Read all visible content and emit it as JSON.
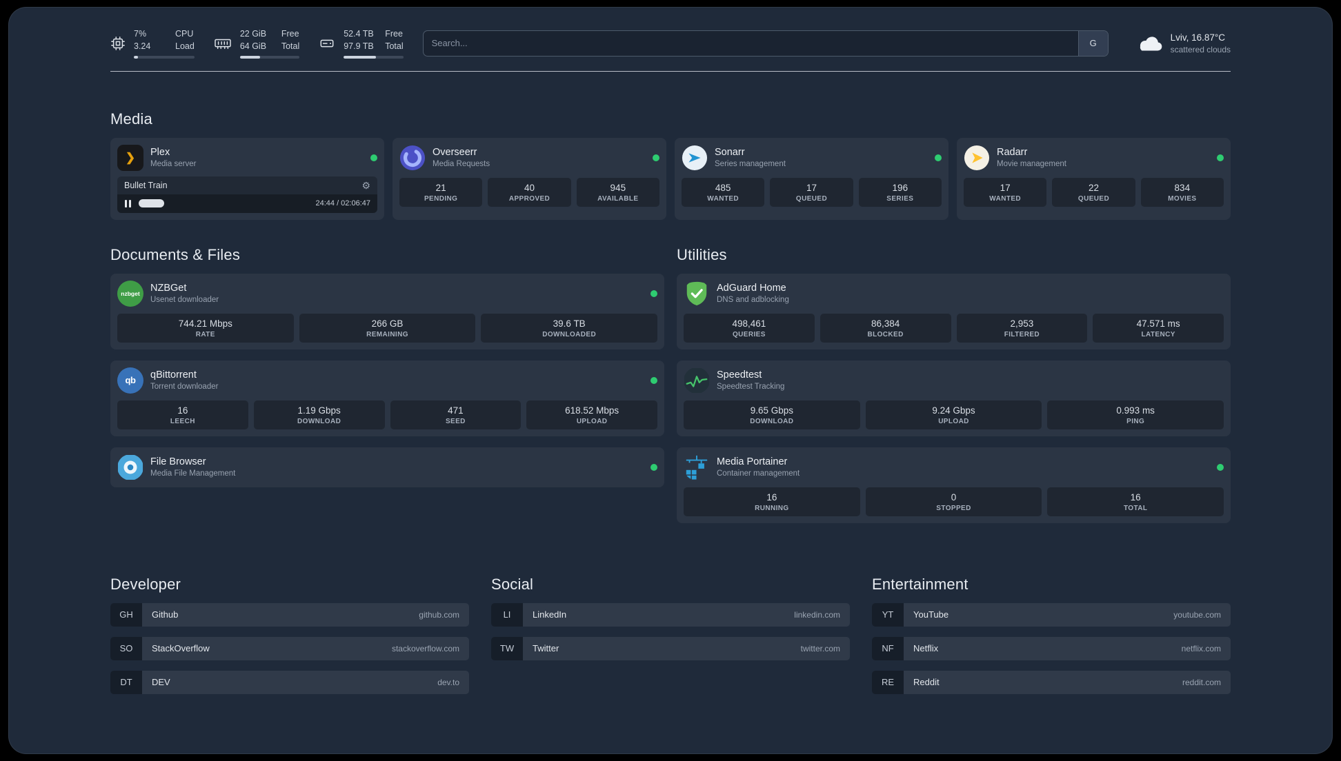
{
  "theme": {
    "accent_green": "#2ecc71",
    "page_bg": "#1f2a3a"
  },
  "topbar": {
    "cpu": {
      "value_top": "7%",
      "value_bottom": "3.24",
      "label_top": "CPU",
      "label_bottom": "Load",
      "bar_percent": 7
    },
    "memory": {
      "value_top": "22 GiB",
      "value_bottom": "64 GiB",
      "label_top": "Free",
      "label_bottom": "Total",
      "bar_percent": 34
    },
    "disk": {
      "value_top": "52.4 TB",
      "value_bottom": "97.9 TB",
      "label_top": "Free",
      "label_bottom": "Total",
      "bar_percent": 54
    },
    "search": {
      "placeholder": "Search...",
      "provider_label": "G"
    },
    "weather": {
      "location": "Lviv, 16.87°C",
      "condition": "scattered clouds"
    }
  },
  "groups": {
    "media": {
      "title": "Media",
      "plex": {
        "name": "Plex",
        "description": "Media server",
        "player": {
          "track": "Bullet Train",
          "time": "24:44 / 02:06:47",
          "progress_percent": 15
        }
      },
      "overseerr": {
        "name": "Overseerr",
        "description": "Media Requests",
        "stats": [
          {
            "value": "21",
            "label": "PENDING"
          },
          {
            "value": "40",
            "label": "APPROVED"
          },
          {
            "value": "945",
            "label": "AVAILABLE"
          }
        ]
      },
      "sonarr": {
        "name": "Sonarr",
        "description": "Series management",
        "stats": [
          {
            "value": "485",
            "label": "WANTED"
          },
          {
            "value": "17",
            "label": "QUEUED"
          },
          {
            "value": "196",
            "label": "SERIES"
          }
        ]
      },
      "radarr": {
        "name": "Radarr",
        "description": "Movie management",
        "stats": [
          {
            "value": "17",
            "label": "WANTED"
          },
          {
            "value": "22",
            "label": "QUEUED"
          },
          {
            "value": "834",
            "label": "MOVIES"
          }
        ]
      }
    },
    "documents": {
      "title": "Documents & Files",
      "nzbget": {
        "name": "NZBGet",
        "description": "Usenet downloader",
        "icon_text": "nzbget",
        "stats": [
          {
            "value": "744.21 Mbps",
            "label": "RATE"
          },
          {
            "value": "266 GB",
            "label": "REMAINING"
          },
          {
            "value": "39.6 TB",
            "label": "DOWNLOADED"
          }
        ]
      },
      "qbittorrent": {
        "name": "qBittorrent",
        "description": "Torrent downloader",
        "icon_text": "qb",
        "stats": [
          {
            "value": "16",
            "label": "LEECH"
          },
          {
            "value": "1.19 Gbps",
            "label": "DOWNLOAD"
          },
          {
            "value": "471",
            "label": "SEED"
          },
          {
            "value": "618.52 Mbps",
            "label": "UPLOAD"
          }
        ]
      },
      "filebrowser": {
        "name": "File Browser",
        "description": "Media File Management"
      }
    },
    "utilities": {
      "title": "Utilities",
      "adguard": {
        "name": "AdGuard Home",
        "description": "DNS and adblocking",
        "stats": [
          {
            "value": "498,461",
            "label": "QUERIES"
          },
          {
            "value": "86,384",
            "label": "BLOCKED"
          },
          {
            "value": "2,953",
            "label": "FILTERED"
          },
          {
            "value": "47.571 ms",
            "label": "LATENCY"
          }
        ]
      },
      "speedtest": {
        "name": "Speedtest",
        "description": "Speedtest Tracking",
        "stats": [
          {
            "value": "9.65 Gbps",
            "label": "DOWNLOAD"
          },
          {
            "value": "9.24 Gbps",
            "label": "UPLOAD"
          },
          {
            "value": "0.993 ms",
            "label": "PING"
          }
        ]
      },
      "portainer": {
        "name": "Media Portainer",
        "description": "Container management",
        "stats": [
          {
            "value": "16",
            "label": "RUNNING"
          },
          {
            "value": "0",
            "label": "STOPPED"
          },
          {
            "value": "16",
            "label": "TOTAL"
          }
        ]
      }
    }
  },
  "bookmarks": {
    "developer": {
      "title": "Developer",
      "items": [
        {
          "abbr": "GH",
          "name": "Github",
          "url": "github.com"
        },
        {
          "abbr": "SO",
          "name": "StackOverflow",
          "url": "stackoverflow.com"
        },
        {
          "abbr": "DT",
          "name": "DEV",
          "url": "dev.to"
        }
      ]
    },
    "social": {
      "title": "Social",
      "items": [
        {
          "abbr": "LI",
          "name": "LinkedIn",
          "url": "linkedin.com"
        },
        {
          "abbr": "TW",
          "name": "Twitter",
          "url": "twitter.com"
        }
      ]
    },
    "entertainment": {
      "title": "Entertainment",
      "items": [
        {
          "abbr": "YT",
          "name": "YouTube",
          "url": "youtube.com"
        },
        {
          "abbr": "NF",
          "name": "Netflix",
          "url": "netflix.com"
        },
        {
          "abbr": "RE",
          "name": "Reddit",
          "url": "reddit.com"
        }
      ]
    }
  }
}
